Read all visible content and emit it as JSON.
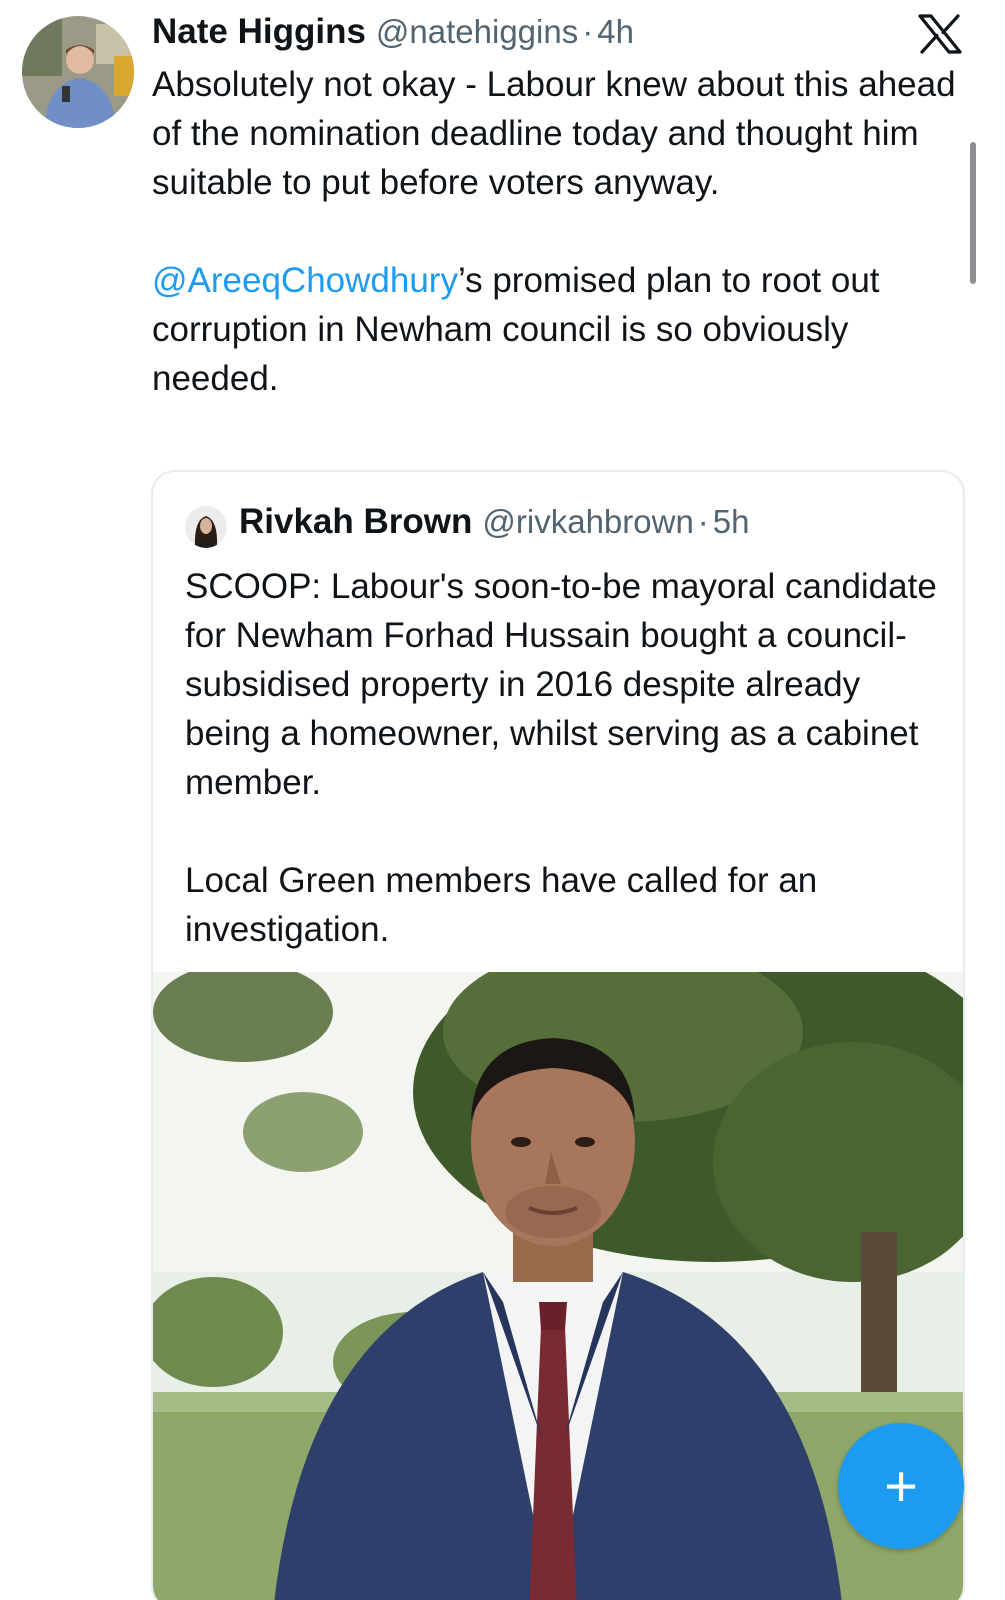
{
  "tweet": {
    "author_name": "Nate Higgins",
    "author_handle": "@natehiggins",
    "time": "4h",
    "paragraph_1": "Absolutely not okay - Labour knew about this ahead of the nomination deadline today and thought him suitable to put before voters anyway.",
    "mention": "@AreeqChowdhury",
    "paragraph_2_rest": "’s promised plan to root out corruption in Newham council is so obviously needed."
  },
  "quoted_tweet": {
    "author_name": "Rivkah Brown",
    "author_handle": "@rivkahbrown",
    "time": "5h",
    "paragraph_1": "SCOOP: Labour's soon-to-be mayoral candidate for Newham Forhad Hussain bought a council-subsidised property in 2016 despite already being a homeowner, whilst serving as a cabinet member.",
    "paragraph_2": "Local Green members have called for an investigation."
  },
  "separator": "·",
  "fab_label": "+",
  "icons": {
    "close": "x-logo-icon",
    "compose": "plus-icon"
  },
  "colors": {
    "accent": "#1d9bf0",
    "text": "#0f1419",
    "muted": "#536471",
    "border": "#e6ecf0"
  }
}
